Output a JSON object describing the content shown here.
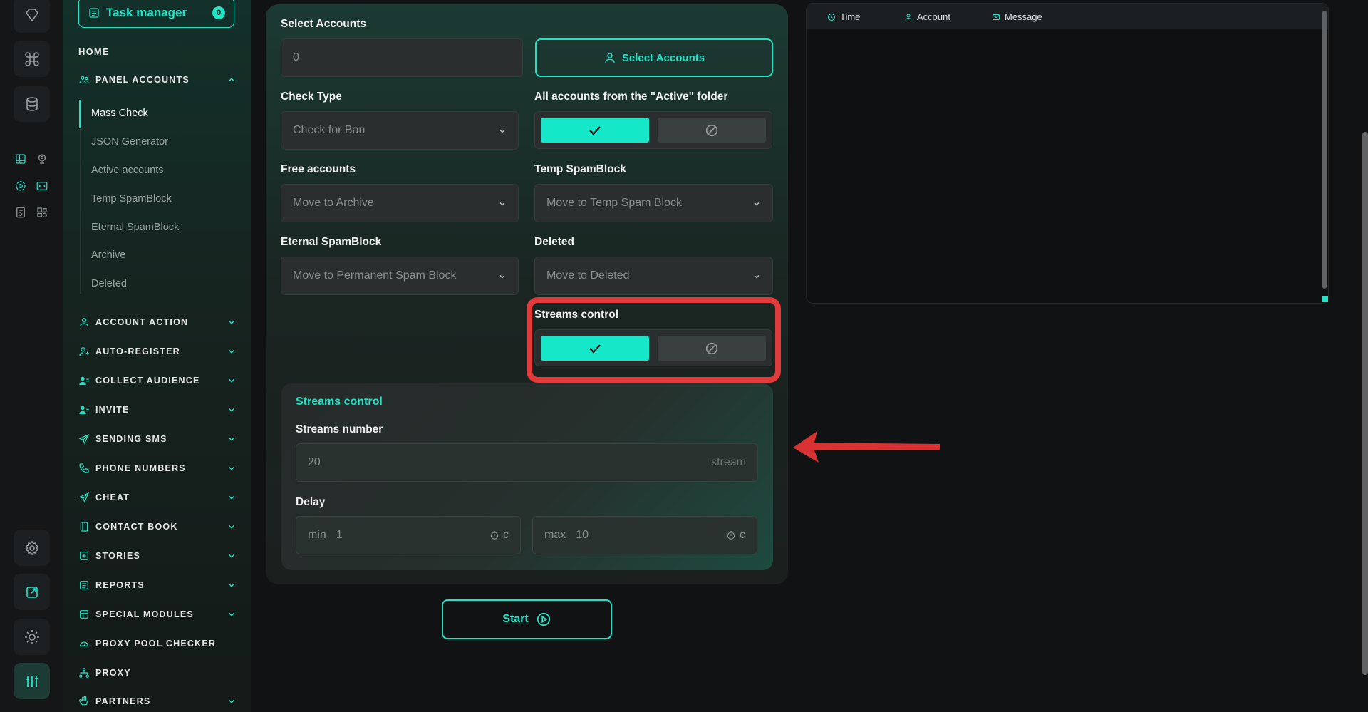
{
  "sidebar": {
    "task_manager": "Task manager",
    "task_count": "0",
    "home": "HOME",
    "panel_accounts": "PANEL ACCOUNTS",
    "sub_items": [
      "Mass Check",
      "JSON Generator",
      "Active accounts",
      "Temp SpamBlock",
      "Eternal SpamBlock",
      "Archive",
      "Deleted"
    ],
    "sections": [
      {
        "label": "ACCOUNT ACTION",
        "icon": "user-icon"
      },
      {
        "label": "AUTO-REGISTER",
        "icon": "user-add-icon"
      },
      {
        "label": "COLLECT AUDIENCE",
        "icon": "users-icon"
      },
      {
        "label": "INVITE",
        "icon": "user-invite-icon"
      },
      {
        "label": "SENDING SMS",
        "icon": "send-icon"
      },
      {
        "label": "PHONE NUMBERS",
        "icon": "phone-icon"
      },
      {
        "label": "CHEAT",
        "icon": "send-icon"
      },
      {
        "label": "CONTACT BOOK",
        "icon": "book-icon"
      },
      {
        "label": "STORIES",
        "icon": "plus-square-icon"
      },
      {
        "label": "REPORTS",
        "icon": "report-icon"
      },
      {
        "label": "SPECIAL MODULES",
        "icon": "modules-icon"
      },
      {
        "label": "PROXY POOL CHECKER",
        "icon": "gauge-icon"
      },
      {
        "label": "PROXY",
        "icon": "network-icon"
      },
      {
        "label": "PARTNERS",
        "icon": "hand-icon"
      }
    ]
  },
  "form": {
    "select_accounts_label": "Select Accounts",
    "select_accounts_value": "0",
    "select_accounts_button": "Select Accounts",
    "check_type_label": "Check Type",
    "check_type_value": "Check for Ban",
    "active_folder_label": "All accounts from the \"Active\" folder",
    "free_accounts_label": "Free accounts",
    "free_accounts_value": "Move to Archive",
    "temp_spamblock_label": "Temp SpamBlock",
    "temp_spamblock_value": "Move to Temp Spam Block",
    "eternal_spamblock_label": "Eternal SpamBlock",
    "eternal_spamblock_value": "Move to Permanent Spam Block",
    "deleted_label": "Deleted",
    "deleted_value": "Move to Deleted",
    "streams_control_label": "Streams control",
    "streams_card_title": "Streams control",
    "streams_number_label": "Streams number",
    "streams_number_value": "20",
    "streams_unit": "stream",
    "delay_label": "Delay",
    "delay_min_prefix": "min",
    "delay_min_value": "1",
    "delay_max_prefix": "max",
    "delay_max_value": "10",
    "delay_unit": "c",
    "start_button": "Start"
  },
  "log": {
    "columns": [
      "Time",
      "Account",
      "Message"
    ]
  },
  "colors": {
    "accent": "#22e3c6",
    "highlight": "#e23a3a"
  }
}
